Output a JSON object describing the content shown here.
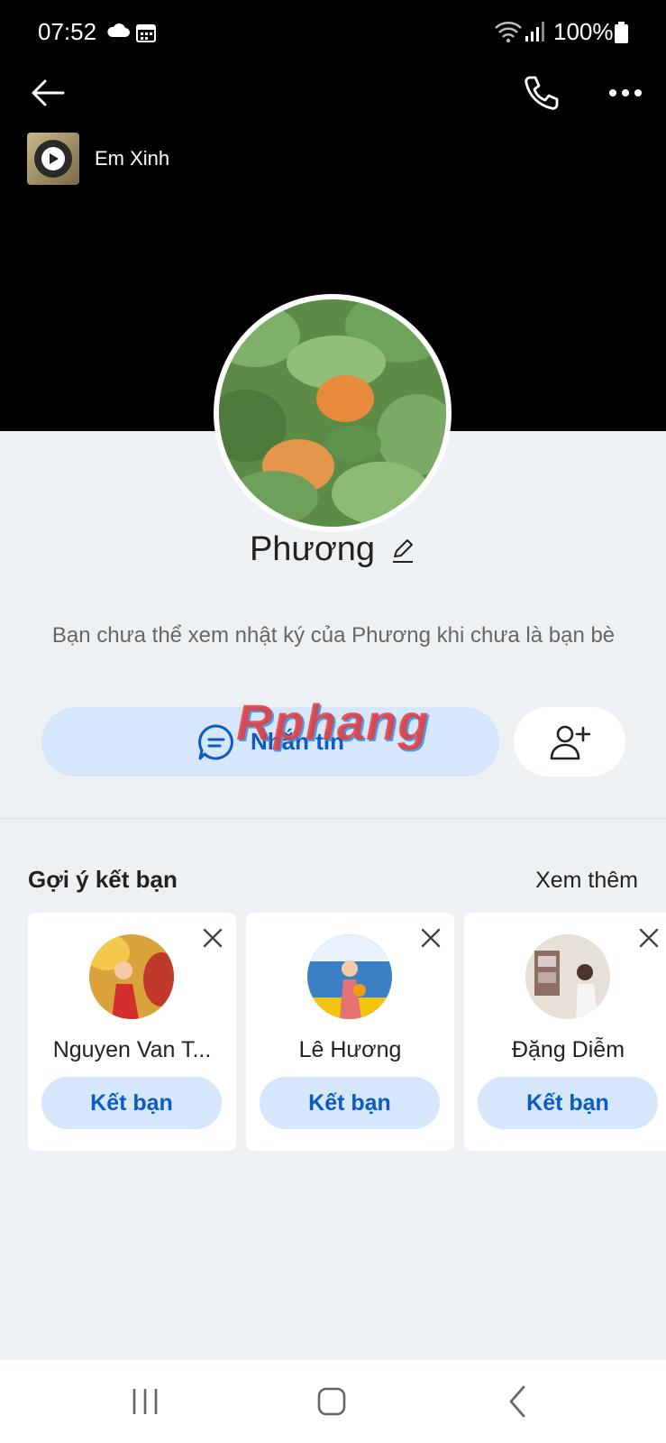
{
  "status_bar": {
    "time": "07:52",
    "battery": "100%"
  },
  "header": {
    "back_icon": "arrow-left-icon",
    "call_icon": "phone-icon",
    "more_icon": "more-horizontal-icon"
  },
  "music": {
    "title": "Em Xinh"
  },
  "profile": {
    "name": "Phương",
    "notice": "Bạn chưa thể xem nhật ký của Phương khi chưa là bạn bè",
    "message_button": "Nhắn tin"
  },
  "watermark": "Rphang",
  "suggestions": {
    "title": "Gợi ý kết bạn",
    "see_more": "Xem thêm",
    "items": [
      {
        "name": "Nguyen Van T...",
        "button": "Kết bạn"
      },
      {
        "name": "Lê Hương",
        "button": "Kết bạn"
      },
      {
        "name": "Đặng Diễm",
        "button": "Kết bạn"
      }
    ]
  },
  "colors": {
    "accent": "#0a5bc4",
    "button_bg": "#d6e6fb",
    "page_bg": "#eef1f4",
    "cover_bg": "#000000"
  }
}
